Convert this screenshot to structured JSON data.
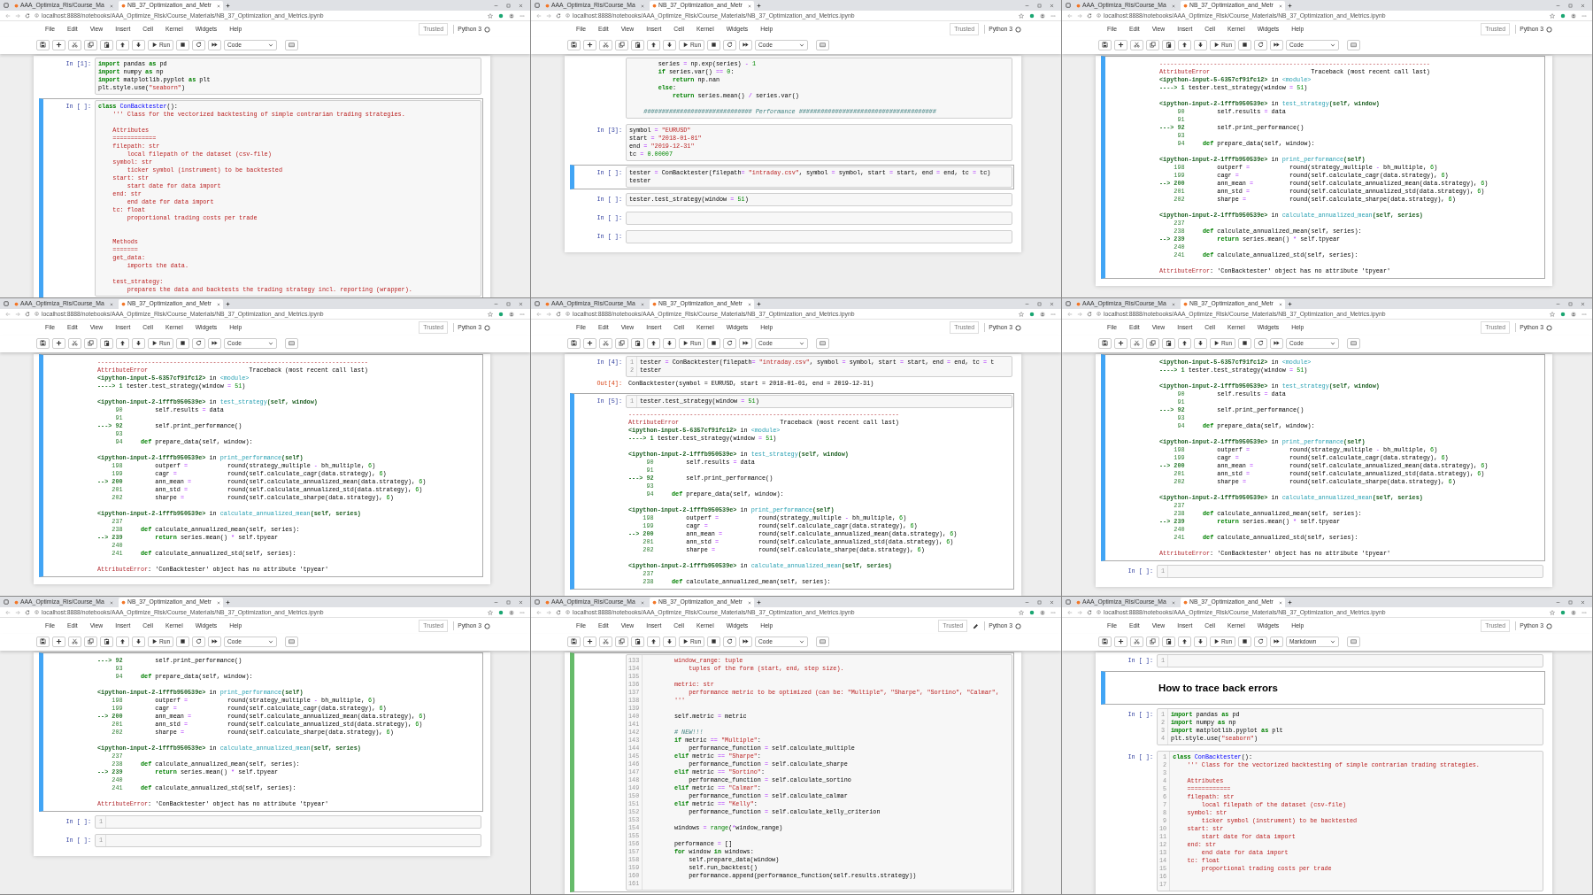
{
  "panels": [
    {
      "tabs": [
        {
          "title": "AAA_Optimiza_Ris/Course_Ma",
          "selected": false
        },
        {
          "title": "NB_37_Optimization_and_Metr",
          "selected": true
        }
      ],
      "url": "localhost:8888/notebooks/AAA_Optimize_Risk/Course_Materials/NB_37_Optimization_and_Metrics.ipynb",
      "menus": [
        "File",
        "Edit",
        "View",
        "Insert",
        "Cell",
        "Kernel",
        "Widgets",
        "Help"
      ],
      "trusted": "Trusted",
      "edit_mode": false,
      "kernel": "Python 3",
      "run_label": "Run",
      "cell_type": "Code",
      "cells": [
        {
          "kind": "code",
          "prompt": "In [1]:",
          "selected": false,
          "code": "import pandas as pd\nimport numpy as np\nimport matplotlib.pyplot as plt\nplt.style.use(\"seaborn\")"
        },
        {
          "kind": "code",
          "prompt": "In [ ]:",
          "selected": true,
          "code": "class ConBacktester():\n    ''' Class for the vectorized backtesting of simple contrarian trading strategies.\n\n    Attributes\n    ============\n    filepath: str\n        local filepath of the dataset (csv-file)\n    symbol: str\n        ticker symbol (instrument) to be backtested\n    start: str\n        start date for data import\n    end: str\n        end date for data import\n    tc: float\n        proportional trading costs per trade\n\n\n    Methods\n    =======\n    get_data:\n        imports the data.\n\n    test_strategy:\n        prepares the data and backtests the trading strategy incl. reporting (wrapper)."
        }
      ]
    },
    {
      "tabs": [
        {
          "title": "AAA_Optimiza_Ris/Course_Ma",
          "selected": false
        },
        {
          "title": "NB_37_Optimization_and_Metr",
          "selected": true
        }
      ],
      "url": "localhost:8888/notebooks/AAA_Optimize_Risk/Course_Materials/NB_37_Optimization_and_Metrics.ipynb",
      "menus": [
        "File",
        "Edit",
        "View",
        "Insert",
        "Cell",
        "Kernel",
        "Widgets",
        "Help"
      ],
      "trusted": "Trusted",
      "edit_mode": false,
      "kernel": "Python 3",
      "run_label": "Run",
      "cell_type": "Code",
      "cells": [
        {
          "kind": "code",
          "selected": false,
          "code": "        series = np.exp(series) - 1\n        if series.var() == 0:\n            return np.nan\n        else:\n            return series.mean() / series.var()\n\n    ############################## Performance ######################################"
        },
        {
          "kind": "code",
          "prompt": "In [3]:",
          "selected": false,
          "code": "symbol = \"EURUSD\"\nstart = \"2018-01-01\"\nend = \"2019-12-31\"\ntc = 0.00007"
        },
        {
          "kind": "code",
          "prompt": "In [ ]:",
          "selected": true,
          "code": "tester = ConBacktester(filepath= \"intraday.csv\", symbol = symbol, start = start, end = end, tc = tc)\ntester"
        },
        {
          "kind": "code",
          "prompt": "In [ ]:",
          "selected": false,
          "code": "tester.test_strategy(window = 51)"
        },
        {
          "kind": "code",
          "prompt": "In [ ]:",
          "selected": false
        },
        {
          "kind": "code",
          "prompt": "In [ ]:",
          "selected": false
        }
      ]
    },
    {
      "tabs": [
        {
          "title": "AAA_Optimiza_Ris/Course_Ma",
          "selected": false
        },
        {
          "title": "NB_37_Optimization_and_Metr",
          "selected": true
        }
      ],
      "url": "localhost:8888/notebooks/AAA_Optimize_Risk/Course_Materials/NB_37_Optimization_and_Metrics.ipynb",
      "menus": [
        "File",
        "Edit",
        "View",
        "Insert",
        "Cell",
        "Kernel",
        "Widgets",
        "Help"
      ],
      "trusted": "Trusted",
      "edit_mode": false,
      "kernel": "Python 3",
      "run_label": "Run",
      "cell_type": "Code",
      "cells": [
        {
          "kind": "code",
          "selected": true,
          "output": {
            "kind": "traceback",
            "text": "---------------------------------------------------------------------------\nAttributeError                            Traceback (most recent call last)\n<ipython-input-5-6357cf91fc12> in <module>\n----> 1 tester.test_strategy(window = 51)\n\n<ipython-input-2-1fffb950539e> in test_strategy(self, window)\n     90         self.results = data\n     91\n---> 92         self.print_performance()\n     93\n     94     def prepare_data(self, window):\n\n<ipython-input-2-1fffb950539e> in print_performance(self)\n    198         outperf =           round(strategy_multiple - bh_multiple, 6)\n    199         cagr =              round(self.calculate_cagr(data.strategy), 6)\n--> 200         ann_mean =          round(self.calculate_annualized_mean(data.strategy), 6)\n    201         ann_std =           round(self.calculate_annualized_std(data.strategy), 6)\n    202         sharpe =            round(self.calculate_sharpe(data.strategy), 6)\n\n<ipython-input-2-1fffb950539e> in calculate_annualized_mean(self, series)\n    237\n    238     def calculate_annualized_mean(self, series):\n--> 239         return series.mean() * self.tpyear\n    240\n    241     def calculate_annualized_std(self, series):\n\nAttributeError: 'ConBacktester' object has no attribute 'tpyear'"
          }
        }
      ]
    },
    {
      "tabs": [
        {
          "title": "AAA_Optimiza_Ris/Course_Ma",
          "selected": false
        },
        {
          "title": "NB_37_Optimization_and_Metr",
          "selected": true
        }
      ],
      "url": "localhost:8888/notebooks/AAA_Optimize_Risk/Course_Materials/NB_37_Optimization_and_Metrics.ipynb",
      "menus": [
        "File",
        "Edit",
        "View",
        "Insert",
        "Cell",
        "Kernel",
        "Widgets",
        "Help"
      ],
      "trusted": "Trusted",
      "edit_mode": false,
      "kernel": "Python 3",
      "run_label": "Run",
      "cell_type": "Code",
      "cells": [
        {
          "kind": "code",
          "selected": true,
          "output": {
            "kind": "traceback",
            "text": "---------------------------------------------------------------------------\nAttributeError                            Traceback (most recent call last)\n<ipython-input-5-6357cf91fc12> in <module>\n----> 1 tester.test_strategy(window = 51)\n\n<ipython-input-2-1fffb950539e> in test_strategy(self, window)\n     90         self.results = data\n     91\n---> 92         self.print_performance()\n     93\n     94     def prepare_data(self, window):\n\n<ipython-input-2-1fffb950539e> in print_performance(self)\n    198         outperf =           round(strategy_multiple - bh_multiple, 6)\n    199         cagr =              round(self.calculate_cagr(data.strategy), 6)\n--> 200         ann_mean =          round(self.calculate_annualized_mean(data.strategy), 6)\n    201         ann_std =           round(self.calculate_annualized_std(data.strategy), 6)\n    202         sharpe =            round(self.calculate_sharpe(data.strategy), 6)\n\n<ipython-input-2-1fffb950539e> in calculate_annualized_mean(self, series)\n    237\n    238     def calculate_annualized_mean(self, series):\n--> 239         return series.mean() * self.tpyear\n    240\n    241     def calculate_annualized_std(self, series):\n\nAttributeError: 'ConBacktester' object has no attribute 'tpyear'"
          }
        }
      ]
    },
    {
      "tabs": [
        {
          "title": "AAA_Optimiza_Ris/Course_Ma",
          "selected": false
        },
        {
          "title": "NB_37_Optimization_and_Metr",
          "selected": true
        }
      ],
      "url": "localhost:8888/notebooks/AAA_Optimize_Risk/Course_Materials/NB_37_Optimization_and_Metrics.ipynb",
      "menus": [
        "File",
        "Edit",
        "View",
        "Insert",
        "Cell",
        "Kernel",
        "Widgets",
        "Help"
      ],
      "trusted": "Trusted",
      "edit_mode": false,
      "kernel": "Python 3",
      "run_label": "Run",
      "cell_type": "Code",
      "cells": [
        {
          "kind": "code",
          "prompt": "In [4]:",
          "selected": false,
          "line_numbers": [
            "1",
            "2"
          ],
          "code": "tester = ConBacktester(filepath= \"intraday.csv\", symbol = symbol, start = start, end = end, tc = t\ntester",
          "output": {
            "kind": "text",
            "prompt": "Out[4]:",
            "text": "ConBacktester(symbol = EURUSD, start = 2018-01-01, end = 2019-12-31)"
          }
        },
        {
          "kind": "code",
          "prompt": "In [5]:",
          "selected": true,
          "line_numbers": [
            "1"
          ],
          "code": "tester.test_strategy(window = 51)",
          "output": {
            "kind": "traceback",
            "text": "---------------------------------------------------------------------------\nAttributeError                            Traceback (most recent call last)\n<ipython-input-5-6357cf91fc12> in <module>\n----> 1 tester.test_strategy(window = 51)\n\n<ipython-input-2-1fffb950539e> in test_strategy(self, window)\n     90         self.results = data\n     91\n---> 92         self.print_performance()\n     93\n     94     def prepare_data(self, window):\n\n<ipython-input-2-1fffb950539e> in print_performance(self)\n    198         outperf =           round(strategy_multiple - bh_multiple, 6)\n    199         cagr =              round(self.calculate_cagr(data.strategy), 6)\n--> 200         ann_mean =          round(self.calculate_annualized_mean(data.strategy), 6)\n    201         ann_std =           round(self.calculate_annualized_std(data.strategy), 6)\n    202         sharpe =            round(self.calculate_sharpe(data.strategy), 6)\n\n<ipython-input-2-1fffb950539e> in calculate_annualized_mean(self, series)\n    237\n    238     def calculate_annualized_mean(self, series):"
          }
        }
      ]
    },
    {
      "tabs": [
        {
          "title": "AAA_Optimiza_Ris/Course_Ma",
          "selected": false
        },
        {
          "title": "NB_37_Optimization_and_Metr",
          "selected": true
        }
      ],
      "url": "localhost:8888/notebooks/AAA_Optimize_Risk/Course_Materials/NB_37_Optimization_and_Metrics.ipynb",
      "menus": [
        "File",
        "Edit",
        "View",
        "Insert",
        "Cell",
        "Kernel",
        "Widgets",
        "Help"
      ],
      "trusted": "Trusted",
      "edit_mode": false,
      "kernel": "Python 3",
      "run_label": "Run",
      "cell_type": "Code",
      "cells": [
        {
          "kind": "code",
          "selected": true,
          "output": {
            "kind": "traceback",
            "text": "<ipython-input-5-6357cf91fc12> in <module>\n----> 1 tester.test_strategy(window = 51)\n\n<ipython-input-2-1fffb950539e> in test_strategy(self, window)\n     90         self.results = data\n     91\n---> 92         self.print_performance()\n     93\n     94     def prepare_data(self, window):\n\n<ipython-input-2-1fffb950539e> in print_performance(self)\n    198         outperf =           round(strategy_multiple - bh_multiple, 6)\n    199         cagr =              round(self.calculate_cagr(data.strategy), 6)\n--> 200         ann_mean =          round(self.calculate_annualized_mean(data.strategy), 6)\n    201         ann_std =           round(self.calculate_annualized_std(data.strategy), 6)\n    202         sharpe =            round(self.calculate_sharpe(data.strategy), 6)\n\n<ipython-input-2-1fffb950539e> in calculate_annualized_mean(self, series)\n    237\n    238     def calculate_annualized_mean(self, series):\n--> 239         return series.mean() * self.tpyear\n    240\n    241     def calculate_annualized_std(self, series):\n\nAttributeError: 'ConBacktester' object has no attribute 'tpyear'"
          }
        },
        {
          "kind": "code",
          "prompt": "In [ ]:",
          "selected": false,
          "line_numbers": [
            "1"
          ]
        }
      ]
    },
    {
      "tabs": [
        {
          "title": "AAA_Optimiza_Ris/Course_Ma",
          "selected": false
        },
        {
          "title": "NB_37_Optimization_and_Metr",
          "selected": true
        }
      ],
      "url": "localhost:8888/notebooks/AAA_Optimize_Risk/Course_Materials/NB_37_Optimization_and_Metrics.ipynb",
      "menus": [
        "File",
        "Edit",
        "View",
        "Insert",
        "Cell",
        "Kernel",
        "Widgets",
        "Help"
      ],
      "trusted": "Trusted",
      "edit_mode": false,
      "kernel": "Python 3",
      "run_label": "Run",
      "cell_type": "Code",
      "cells": [
        {
          "kind": "code",
          "selected": true,
          "output": {
            "kind": "traceback",
            "text": "---> 92         self.print_performance()\n     93\n     94     def prepare_data(self, window):\n\n<ipython-input-2-1fffb950539e> in print_performance(self)\n    198         outperf =           round(strategy_multiple - bh_multiple, 6)\n    199         cagr =              round(self.calculate_cagr(data.strategy), 6)\n--> 200         ann_mean =          round(self.calculate_annualized_mean(data.strategy), 6)\n    201         ann_std =           round(self.calculate_annualized_std(data.strategy), 6)\n    202         sharpe =            round(self.calculate_sharpe(data.strategy), 6)\n\n<ipython-input-2-1fffb950539e> in calculate_annualized_mean(self, series)\n    237\n    238     def calculate_annualized_mean(self, series):\n--> 239         return series.mean() * self.tpyear\n    240\n    241     def calculate_annualized_std(self, series):\n\nAttributeError: 'ConBacktester' object has no attribute 'tpyear'"
          }
        },
        {
          "kind": "code",
          "prompt": "In [ ]:",
          "selected": false,
          "line_numbers": [
            "1"
          ]
        },
        {
          "kind": "code",
          "prompt": "In [ ]:",
          "selected": false,
          "line_numbers": [
            "1"
          ]
        }
      ]
    },
    {
      "tabs": [
        {
          "title": "AAA_Optimiza_Ris/Course_Ma",
          "selected": false
        },
        {
          "title": "NB_37_Optimization_and_Metr",
          "selected": true
        }
      ],
      "url": "localhost:8888/notebooks/AAA_Optimize_Risk/Course_Materials/NB_37_Optimization_and_Metrics.ipynb",
      "menus": [
        "File",
        "Edit",
        "View",
        "Insert",
        "Cell",
        "Kernel",
        "Widgets",
        "Help"
      ],
      "trusted": "Trusted",
      "edit_mode": true,
      "kernel": "Python 3",
      "run_label": "Run",
      "cell_type": "Code",
      "cells": [
        {
          "kind": "code",
          "selected": true,
          "in_docstring": true,
          "line_numbers": [
            "133",
            "134",
            "135",
            "136",
            "137",
            "138",
            "139",
            "140",
            "141",
            "142",
            "143",
            "144",
            "145",
            "146",
            "147",
            "148",
            "149",
            "150",
            "151",
            "152",
            "153",
            "154",
            "155",
            "156",
            "157",
            "158",
            "159",
            "160",
            "161"
          ],
          "code": "        window_range: tuple\n            tuples of the form (start, end, step size).\n\n        metric: str\n            performance metric to be optimized (can be: \"Multiple\", \"Sharpe\", \"Sortino\", \"Calmar\",\n        '''\n\n        self.metric = metric\n\n        # NEW!!!\n        if metric == \"Multiple\":\n            performance_function = self.calculate_multiple\n        elif metric == \"Sharpe\":\n            performance_function = self.calculate_sharpe\n        elif metric == \"Sortino\":\n            performance_function = self.calculate_sortino\n        elif metric == \"Calmar\":\n            performance_function = self.calculate_calmar\n        elif metric == \"Kelly\":\n            performance_function = self.calculate_kelly_criterion\n\n        windows = range(*window_range)\n\n        performance = []\n        for window in windows:\n            self.prepare_data(window)\n            self.run_backtest()\n            performance.append(performance_function(self.results.strategy))\n"
        }
      ]
    },
    {
      "tabs": [
        {
          "title": "AAA_Optimiza_Ris/Course_Ma",
          "selected": false
        },
        {
          "title": "NB_37_Optimization_and_Metr",
          "selected": true
        }
      ],
      "url": "localhost:8888/notebooks/AAA_Optimize_Risk/Course_Materials/NB_37_Optimization_and_Metrics.ipynb",
      "menus": [
        "File",
        "Edit",
        "View",
        "Insert",
        "Cell",
        "Kernel",
        "Widgets",
        "Help"
      ],
      "trusted": "Trusted",
      "edit_mode": false,
      "kernel": "Python 3",
      "run_label": "Run",
      "cell_type": "Markdown",
      "cells": [
        {
          "kind": "code",
          "prompt": "In [ ]:",
          "selected": false,
          "line_numbers": [
            "1"
          ]
        },
        {
          "kind": "markdown",
          "selected": true,
          "heading": "How to trace back errors"
        },
        {
          "kind": "code",
          "prompt": "In [ ]:",
          "selected": false,
          "line_numbers": [
            "1",
            "2",
            "3",
            "4"
          ],
          "code": "import pandas as pd\nimport numpy as np\nimport matplotlib.pyplot as plt\nplt.style.use(\"seaborn\")"
        },
        {
          "kind": "code",
          "prompt": "In [ ]:",
          "selected": false,
          "line_numbers": [
            "1",
            "2",
            "3",
            "4",
            "5",
            "6",
            "7",
            "8",
            "9",
            "10",
            "11",
            "12",
            "13",
            "14",
            "15",
            "16",
            "17"
          ],
          "code": "class ConBacktester():\n    ''' Class for the vectorized backtesting of simple contrarian trading strategies.\n\n    Attributes\n    ============\n    filepath: str\n        local filepath of the dataset (csv-file)\n    symbol: str\n        ticker symbol (instrument) to be backtested\n    start: str\n        start date for data import\n    end: str\n        end date for data import\n    tc: float\n        proportional trading costs per trade\n\n"
        }
      ]
    }
  ]
}
